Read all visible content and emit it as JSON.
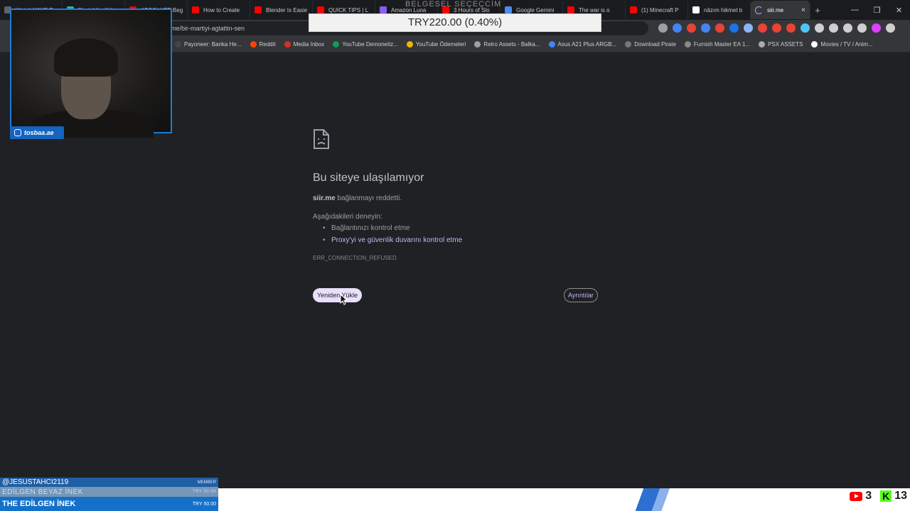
{
  "browser": {
    "tabs": [
      {
        "title": "Watch WWE R",
        "color": "#5f6368"
      },
      {
        "title": "Bir dakika lütfe",
        "color": "#2bb3a7"
      },
      {
        "title": "ABSOLUTE Beg",
        "color": "#ff0000"
      },
      {
        "title": "How to Create",
        "color": "#ff0000"
      },
      {
        "title": "Blender Is Easie",
        "color": "#ff0000"
      },
      {
        "title": "QUICK TIPS | L",
        "color": "#ff0000"
      },
      {
        "title": "Amazon Luna",
        "color": "#8a5cf6"
      },
      {
        "title": "3 Hours of Slo",
        "color": "#ff0000"
      },
      {
        "title": "Google Gemini",
        "color": "#4b8cf5"
      },
      {
        "title": "The war is o",
        "color": "#ff0000"
      },
      {
        "title": "(1) Minecraft P",
        "color": "#ff0000"
      },
      {
        "title": "nâzım hikmet b",
        "color": "#ffffff"
      }
    ],
    "active_tab": {
      "title": "siir.me",
      "close": "×"
    },
    "new_tab": "+",
    "window_controls": {
      "minimize": "—",
      "restore": "❐",
      "close": "✕"
    },
    "url_path": "me/bir-martiyi-aglattin-sen",
    "bookmarks": [
      {
        "label": "Payoneer: Banka He...",
        "color": "#444"
      },
      {
        "label": "Reddit",
        "color": "#ff4500"
      },
      {
        "label": "Media Inbox",
        "color": "#d93025"
      },
      {
        "label": "YouTube Demonetiz...",
        "color": "#0f9d58"
      },
      {
        "label": "YouTube Ödemeleri",
        "color": "#f4b400"
      },
      {
        "label": "Retro Assets - Balka...",
        "color": "#9aa0a6"
      },
      {
        "label": "Asus A21 Plus ARGB...",
        "color": "#4285f4"
      },
      {
        "label": "Download Pirate",
        "color": "#777"
      },
      {
        "label": "Furnish Master EA 1...",
        "color": "#888"
      },
      {
        "label": "PSX ASSETS",
        "color": "#aaa"
      },
      {
        "label": "Movies / TV / Anim...",
        "color": "#fff"
      }
    ],
    "extension_colors": [
      "#9aa0a6",
      "#4285f4",
      "#ea4335",
      "#4285f4",
      "#ea4335",
      "#1a73e8",
      "#8ab4f8",
      "#ea4335",
      "#ea4335",
      "#ea4335",
      "#4fc3f7",
      "#cfcfcf",
      "#cfcfcf",
      "#cfcfcf",
      "#cfcfcf",
      "#e040fb",
      "#cfcfcf"
    ]
  },
  "overlay": {
    "price_top": "BELGESEL SEÇEÇCİM",
    "price": "TRY220.00 (0.40%)"
  },
  "webcam": {
    "handle": "tosbaa.ae"
  },
  "error_page": {
    "title": "Bu siteye ulaşılamıyor",
    "host": "siir.me",
    "subtitle_rest": "bağlanmayı reddetti.",
    "try_label": "Aşağıdakileri deneyin:",
    "suggestions": [
      "Bağlantınızı kontrol etme",
      "Proxy'yi ve güvenlik duvarını kontrol etme"
    ],
    "error_code": "ERR_CONNECTION_REFUSED",
    "reload_button": "Yeniden Yükle",
    "details_button": "Ayrıntılar"
  },
  "stream": {
    "chat": [
      {
        "name": "@JESUSTAHCI2119",
        "tag": "MEMBER"
      },
      {
        "name": "EDİLGEN BEYAZ İNEK",
        "tag": "TRY 50.00"
      },
      {
        "name": "THE EDİLGEN İNEK",
        "tag": "TRY 50.00"
      }
    ],
    "youtube_count": "3",
    "kick_count": "13",
    "kick_letter": "K"
  }
}
